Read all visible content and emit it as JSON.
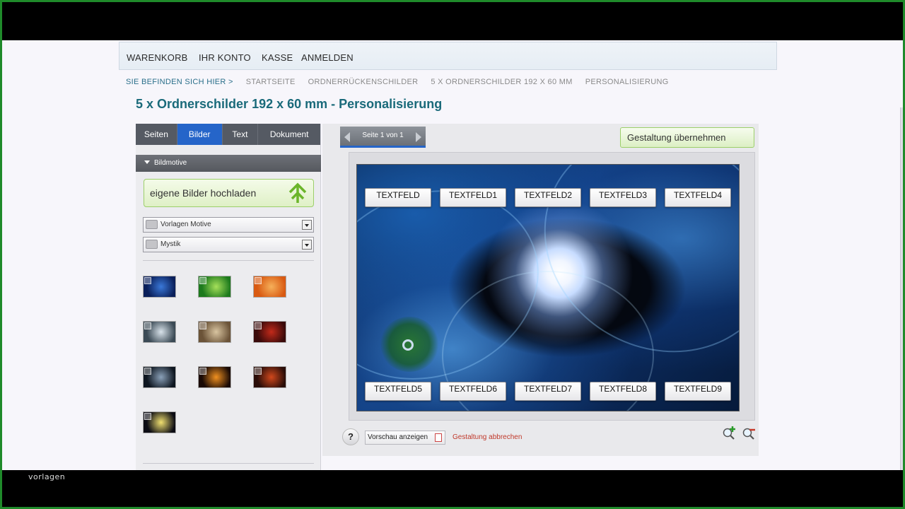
{
  "nav": [
    "WARENKORB",
    "IHR KONTO",
    "KASSE",
    "ANMELDEN"
  ],
  "breadcrumb": {
    "label": "SIE BEFINDEN SICH HIER >",
    "items": [
      "STARTSEITE",
      "ORDNERRÜCKENSCHILDER",
      "5 X ORDNERSCHILDER 192 X 60 MM",
      "PERSONALISIERUNG"
    ]
  },
  "page_title": "5 x Ordnerschilder 192 x 60 mm - Personalisierung",
  "tabs": [
    "Seiten",
    "Bilder",
    "Text",
    "Dokument"
  ],
  "active_tab": "Bilder",
  "section_title": "Bildmotive",
  "upload_label": "eigene Bilder hochladen",
  "dropdowns": [
    "Vorlagen Motive",
    "Mystik"
  ],
  "thumbnails": [
    {
      "icon": "space-galaxy",
      "colors": [
        "#0a1f5a",
        "#3a78d8"
      ]
    },
    {
      "icon": "green-orb",
      "colors": [
        "#1d7a1d",
        "#a6e05a"
      ]
    },
    {
      "icon": "orange-swirl",
      "colors": [
        "#d95a12",
        "#f6b05a"
      ]
    },
    {
      "icon": "jet-plane",
      "colors": [
        "#3b4a55",
        "#d8e2ea"
      ]
    },
    {
      "icon": "beige-figure",
      "colors": [
        "#6b5338",
        "#d8c4a0"
      ]
    },
    {
      "icon": "red-dragon",
      "colors": [
        "#3a0a0a",
        "#c22a1a"
      ]
    },
    {
      "icon": "planet-dark",
      "colors": [
        "#0e1620",
        "#8aa0b8"
      ]
    },
    {
      "icon": "fire-sword",
      "colors": [
        "#1a0a05",
        "#f09020"
      ]
    },
    {
      "icon": "red-fantasy",
      "colors": [
        "#2a0d08",
        "#d0481c"
      ]
    },
    {
      "icon": "moon-landscape",
      "colors": [
        "#0c0c14",
        "#f0e070"
      ]
    }
  ],
  "pager_label": "Seite 1 von 1",
  "apply_button": "Gestaltung übernehmen",
  "textfields_top": [
    "TEXTFELD",
    "TEXTFELD1",
    "TEXTFELD2",
    "TEXTFELD3",
    "TEXTFELD4"
  ],
  "textfields_bottom": [
    "TEXTFELD5",
    "TEXTFELD6",
    "TEXTFELD7",
    "TEXTFELD8",
    "TEXTFELD9"
  ],
  "help_label": "?",
  "preview_button": "Vorschau anzeigen",
  "cancel_link": "Gestaltung abbrechen",
  "caption": "vorlagen",
  "colors": {
    "accent_blue": "#2565c9",
    "title_teal": "#1a6a7a",
    "green_button": "#9ccf6a",
    "cancel_red": "#c0392b"
  }
}
